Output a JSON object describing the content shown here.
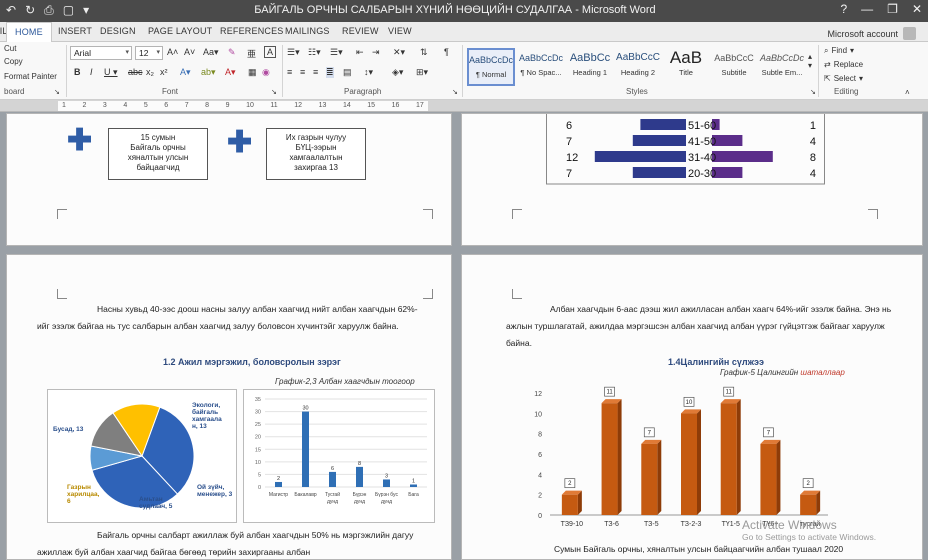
{
  "window": {
    "title": "БАЙГАЛЬ ОРЧНЫ САЛБАРЫН ХҮНИЙ НӨӨЦИЙН СУДАЛГАА - Microsoft Word",
    "controls": [
      "?",
      "—",
      "❐",
      "✕"
    ]
  },
  "tabs": [
    "FILE",
    "HOME",
    "INSERT",
    "DESIGN",
    "PAGE LAYOUT",
    "REFERENCES",
    "MAILINGS",
    "REVIEW",
    "VIEW"
  ],
  "account": "Microsoft account",
  "ribbon": {
    "clipboard": {
      "cut": "Cut",
      "copy": "Copy",
      "format_painter": "Format Painter",
      "label": "board"
    },
    "font": {
      "name": "Arial",
      "size": "12",
      "label": "Font"
    },
    "paragraph": {
      "label": "Paragraph"
    },
    "styles": {
      "label": "Styles",
      "items": [
        {
          "sample": "AaBbCcDc",
          "name": "¶ Normal"
        },
        {
          "sample": "AaBbCcDc",
          "name": "¶ No Spac..."
        },
        {
          "sample": "AaBbCc",
          "name": "Heading 1"
        },
        {
          "sample": "AaBbCcC",
          "name": "Heading 2"
        },
        {
          "sample": "AaB",
          "name": "Title"
        },
        {
          "sample": "AaBbCcC",
          "name": "Subtitle"
        },
        {
          "sample": "AaBbCcDc",
          "name": "Subtle Em..."
        }
      ]
    },
    "editing": {
      "find": "Find",
      "replace": "Replace",
      "select": "Select",
      "label": "Editing"
    }
  },
  "ruler": {
    "marks": [
      "1",
      "2",
      "3",
      "4",
      "5",
      "6",
      "7",
      "8",
      "9",
      "10",
      "11",
      "12",
      "13",
      "14",
      "15",
      "16",
      "17"
    ]
  },
  "page_top_left": {
    "box1": [
      "15 сумын",
      "Байгаль орчны",
      "хяналтын улсын",
      "байцаагчид"
    ],
    "box2": [
      "Их газрын чулуу",
      "БҮЦ-ээрын",
      "хамгаалалтын",
      "захиргаа 13"
    ]
  },
  "page_bottom_left": {
    "paragraph1": "Насны хувьд 40-ээс доош насны залуу албан хаагчид нийт албан хаагчдын 62%-ийг эзэлж байгаа нь тус салбарын албан хаагчид залуу боловсон хүчинтэйг харуулж байна.",
    "heading": "1.2 Ажил мэргэжил, боловсролын зэрэг",
    "caption": "График-2,3 Албан хаагчдын тоогоор",
    "paragraph2": "Байгаль орчны салбарт ажиллаж буй албан хаагчдын 50% нь мэргэжлийн дагуу ажиллаж буй албан хаагчид байгаа бөгөөд төрийн захиргааны албан"
  },
  "page_bottom_right": {
    "paragraph1": "Албан хаагчдын 6-аас дээш жил ажилласан албан хаагч 64%-ийг эзэлж байна. Энэ нь ажлын туршлагатай, ажилдаа мэргэшсэн албан хаагчид албан үүрэг гүйцэтгэж байгааг харуулж байна.",
    "heading": "1.4Цалингийн сүлжээ",
    "caption_prefix": "График-5 Цалингийн ",
    "caption_red": "шаталлаар",
    "footer": "Сумын Байгаль орчны, хяналтын улсын байцаагчийн албан тушаал 2020"
  },
  "watermark": {
    "line1": "Activate Windows",
    "line2": "Go to Settings to activate Windows."
  },
  "chart_data": [
    {
      "type": "bar",
      "orientation": "horizontal",
      "categories": [
        "51-60",
        "41-50",
        "31-40",
        "20-30"
      ],
      "left_labels": [
        "6",
        "7",
        "12",
        "7"
      ],
      "right_labels": [
        "1",
        "4",
        "8",
        "4"
      ],
      "series": [
        {
          "values": [
            6,
            7,
            12,
            7
          ],
          "color": "#2e3a8c"
        },
        {
          "values": [
            1,
            4,
            8,
            4
          ],
          "color": "#5b2d8a"
        }
      ]
    },
    {
      "type": "pie",
      "slices": [
        {
          "label": "Бусад, 13",
          "value": 13,
          "color": "#2f63b8"
        },
        {
          "label": "Экологи, байгаль хамгаала н, 13",
          "value": 13,
          "color": "#2f63b8"
        },
        {
          "label": "Ой зүйч, менежер, 3",
          "value": 3,
          "color": "#5b9bd5"
        },
        {
          "label": "Амьтан судлаач, 5",
          "value": 5,
          "color": "#7f7f7f"
        },
        {
          "label": "Газрын харилцаа, 6",
          "value": 6,
          "color": "#ffc000"
        }
      ]
    },
    {
      "type": "bar",
      "categories": [
        "Магистр",
        "Бакалавр",
        "Тусгай дунд",
        "Бүрэн дунд",
        "Бүрэн бус дунд",
        "Бага"
      ],
      "values": [
        2,
        30,
        6,
        8,
        3,
        1
      ],
      "ylim": [
        0,
        35
      ],
      "yticks": [
        0,
        5,
        10,
        15,
        20,
        25,
        30,
        35
      ],
      "color": "#2f6fb5"
    },
    {
      "type": "bar",
      "categories": [
        "ТЗ9-10",
        "ТЗ-6",
        "ТЗ-5",
        "ТЗ-2-3",
        "ТҮ1-5",
        "ТҮ6+",
        "тусгай"
      ],
      "values": [
        2,
        11,
        7,
        10,
        11,
        7,
        2
      ],
      "ylim": [
        0,
        12
      ],
      "yticks": [
        0,
        2,
        4,
        6,
        8,
        10,
        12
      ],
      "color": "#c55a11"
    }
  ]
}
